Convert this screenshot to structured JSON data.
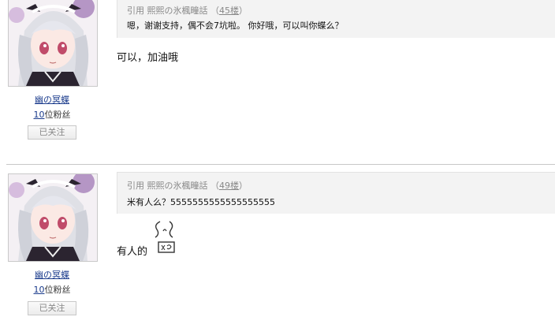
{
  "posts": [
    {
      "user": {
        "name": "幽の冥蝶",
        "fans_count": "10",
        "fans_suffix": "位粉丝",
        "follow_label": "已关注"
      },
      "quote": {
        "prefix": "引用",
        "author": "熙熙の氷楓疃話",
        "floor_open": "（",
        "floor": "45楼",
        "floor_close": "）",
        "text": "嗯，谢谢支持，偶不会7坑啦。 你好哦，可以叫你蝶么？"
      },
      "reply": "可以，加油哦"
    },
    {
      "user": {
        "name": "幽の冥蝶",
        "fans_count": "10",
        "fans_suffix": "位粉丝",
        "follow_label": "已关注"
      },
      "quote": {
        "prefix": "引用",
        "author": "熙熙の氷楓疃話",
        "floor_open": "（",
        "floor": "49楼",
        "floor_close": "）",
        "text": "米有人么？5555555555555555555"
      },
      "reply": "有人的",
      "emoji": "chat-emoticon-icon"
    }
  ]
}
